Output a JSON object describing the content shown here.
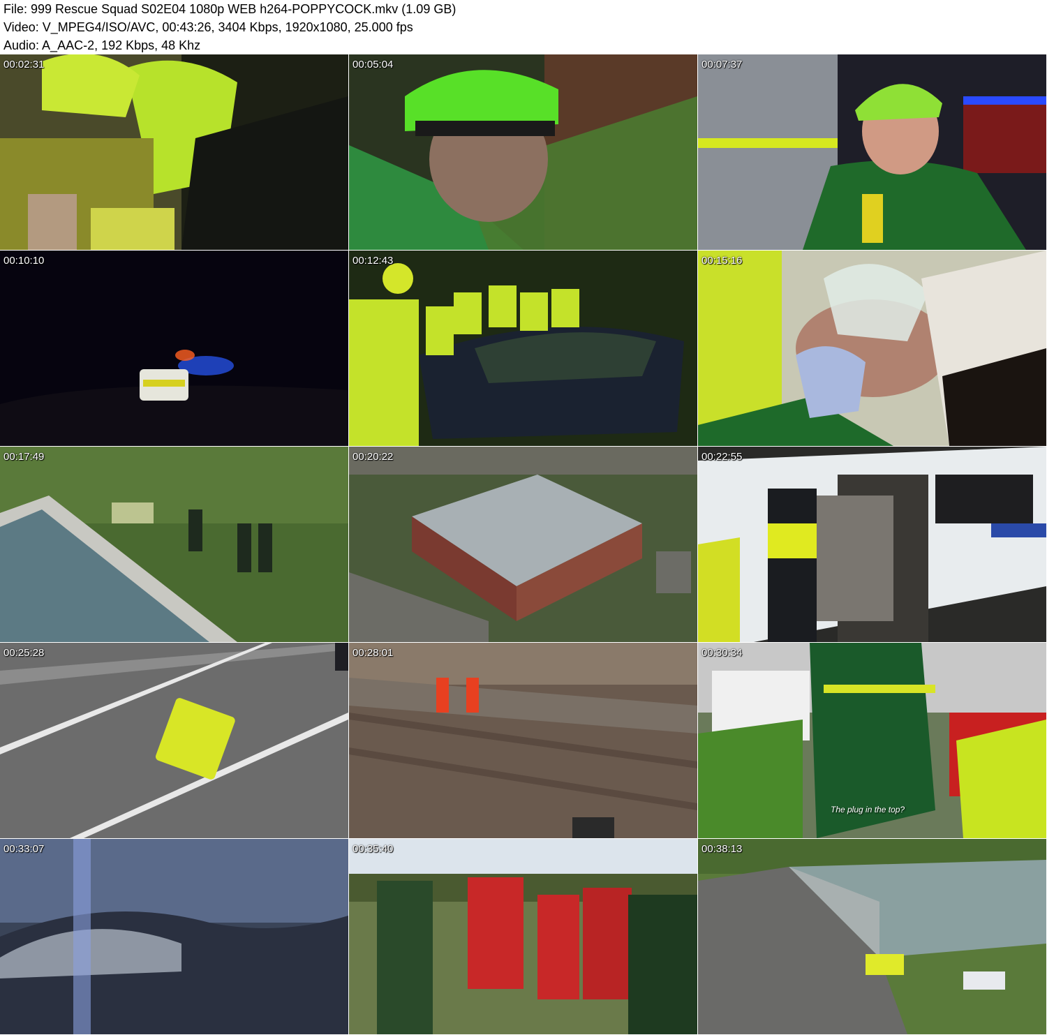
{
  "header": {
    "file_line": "File: 999 Rescue Squad S02E04 1080p WEB h264-POPPYCOCK.mkv (1.09 GB)",
    "video_line": "Video: V_MPEG4/ISO/AVC, 00:43:26, 3404 Kbps, 1920x1080, 25.000 fps",
    "audio_line": "Audio: A_AAC-2, 192 Kbps, 48 Khz"
  },
  "thumbnails": [
    {
      "timestamp": "00:02:31",
      "scene": "firefighters-in-car-night"
    },
    {
      "timestamp": "00:05:04",
      "scene": "paramedic-green-helmet-petzl"
    },
    {
      "timestamp": "00:07:37",
      "scene": "paramedic-interview-night"
    },
    {
      "timestamp": "00:10:10",
      "scene": "blue-lights-road-night"
    },
    {
      "timestamp": "00:12:43",
      "scene": "crew-around-crashed-car"
    },
    {
      "timestamp": "00:15:16",
      "scene": "patient-oxygen-mask"
    },
    {
      "timestamp": "00:17:49",
      "scene": "crew-in-garden-by-pool"
    },
    {
      "timestamp": "00:20:22",
      "scene": "aerial-warehouse-car-park"
    },
    {
      "timestamp": "00:22:55",
      "scene": "police-officer-van"
    },
    {
      "timestamp": "00:25:28",
      "scene": "aerial-ambulance-motorway"
    },
    {
      "timestamp": "00:28:01",
      "scene": "workers-on-railway"
    },
    {
      "timestamp": "00:30:34",
      "scene": "crew-near-fire-engine",
      "subtitle": "The plug in the top?"
    },
    {
      "timestamp": "00:33:07",
      "scene": "blurred-water-light"
    },
    {
      "timestamp": "00:35:40",
      "scene": "water-rescue-team-field"
    },
    {
      "timestamp": "00:38:13",
      "scene": "aerial-ambulance-station"
    }
  ]
}
